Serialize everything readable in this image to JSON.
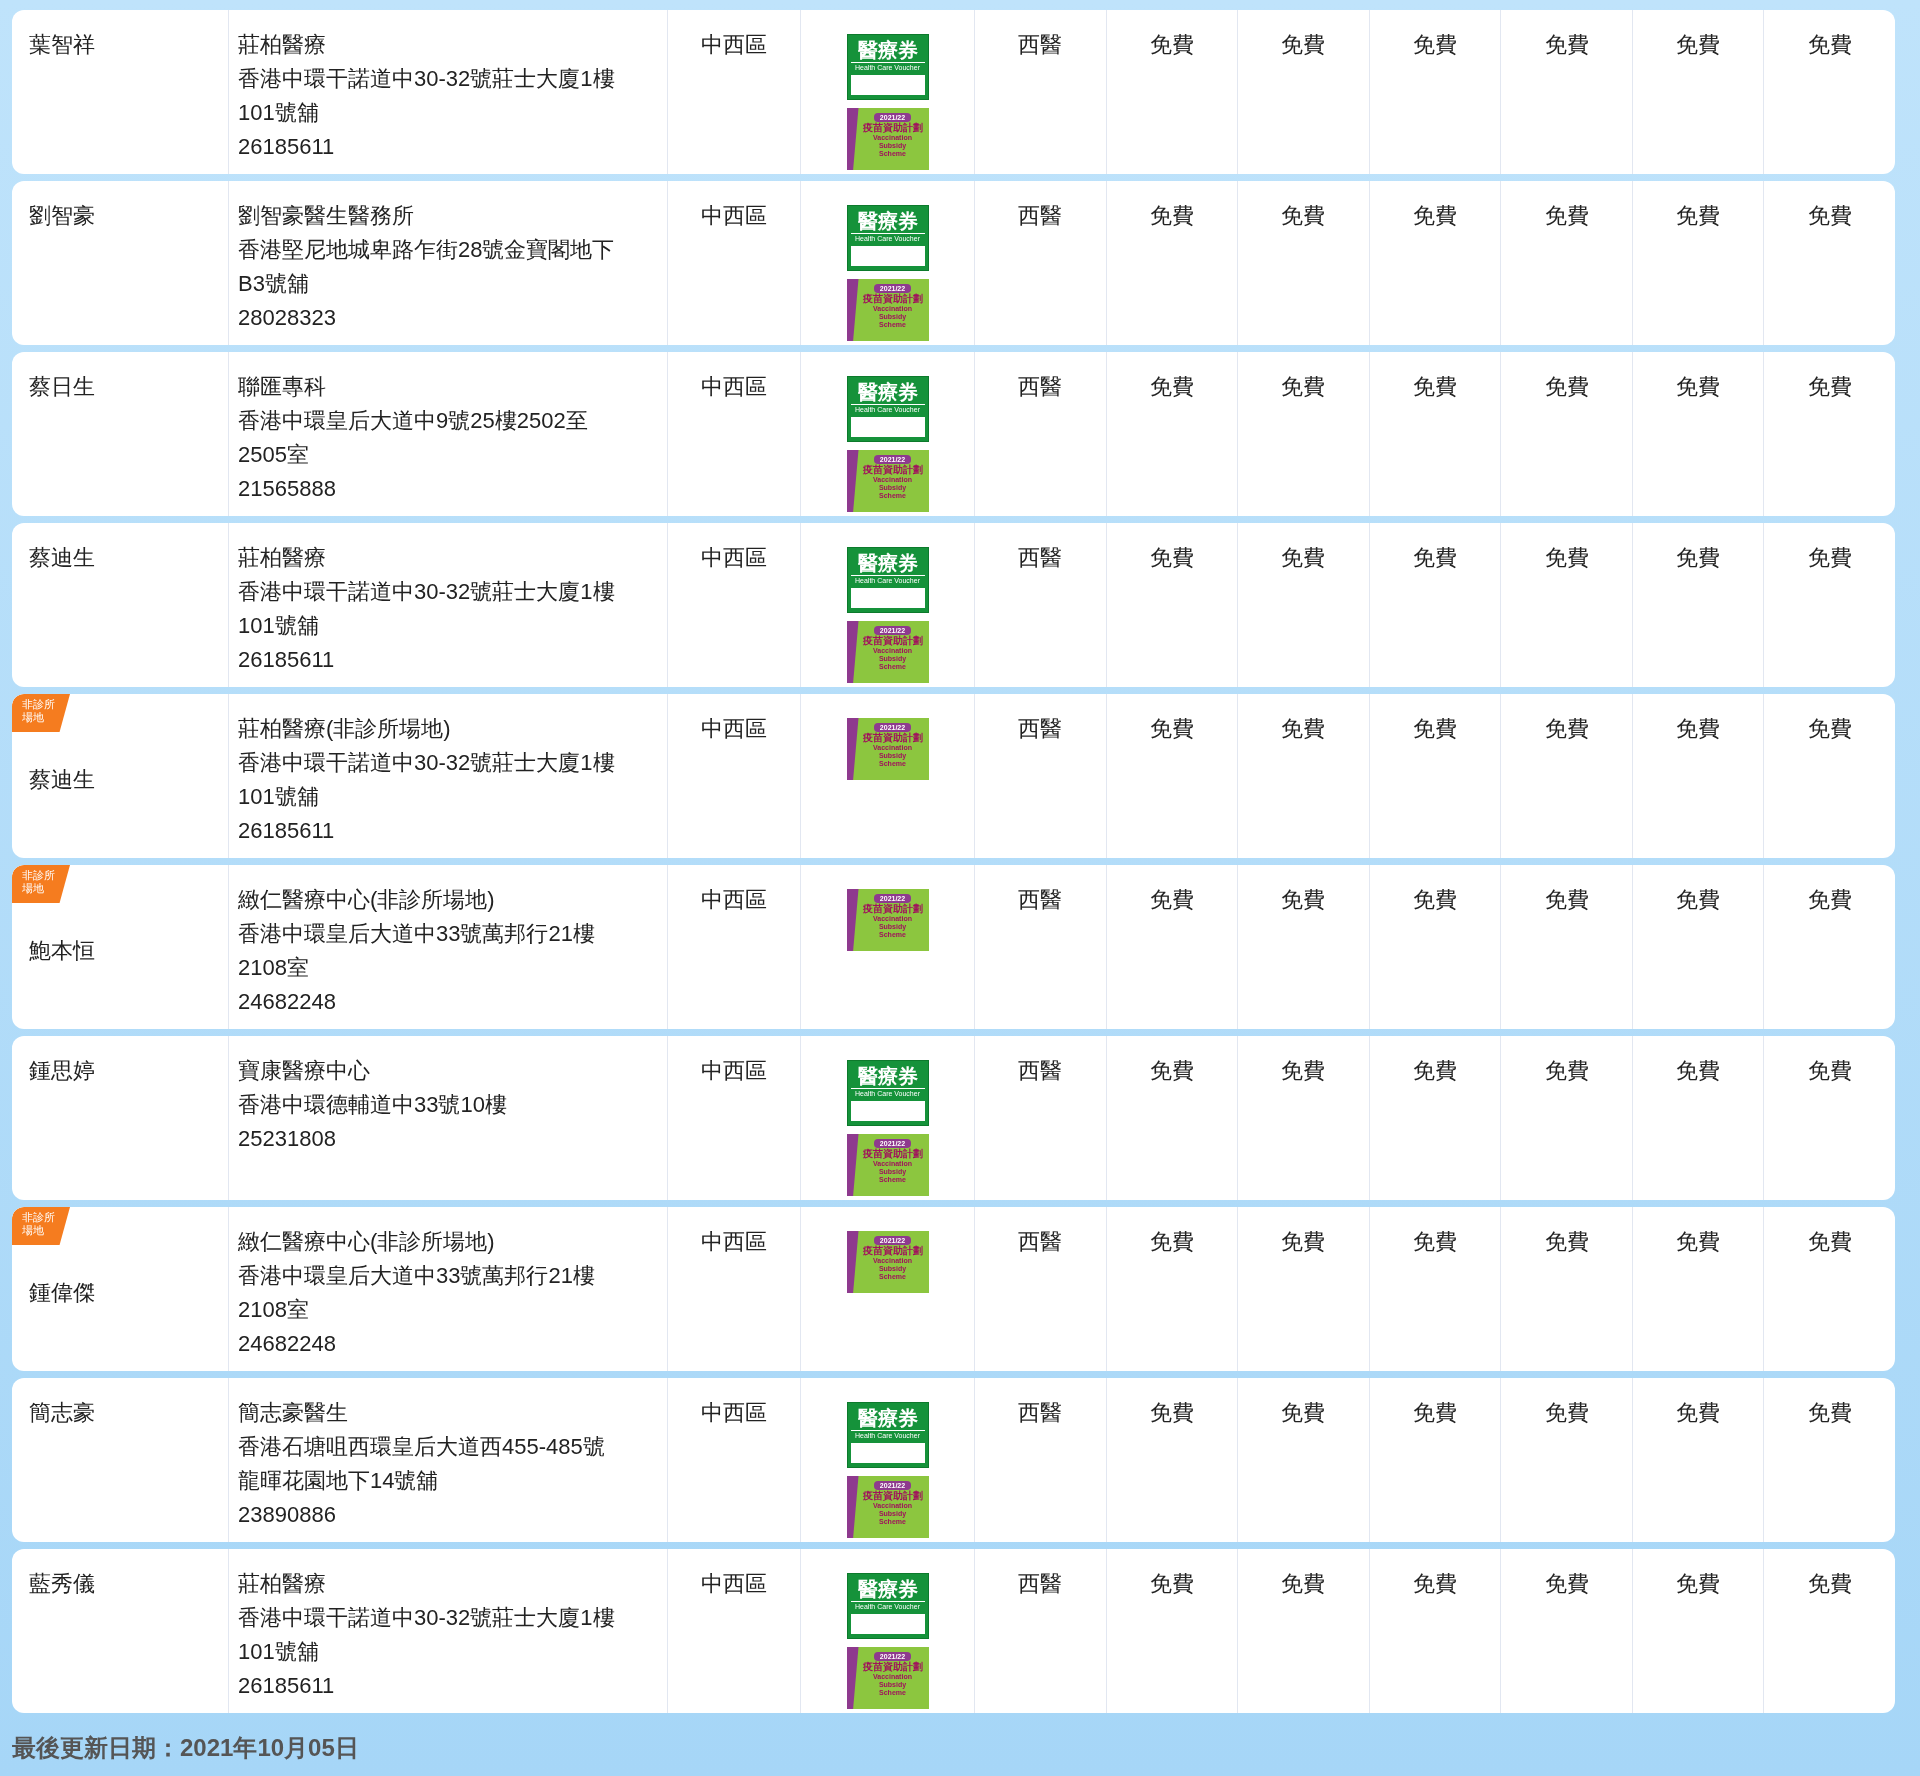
{
  "rows": [
    {
      "name": "葉智祥",
      "clinic": "莊柏醫療",
      "address": [
        "香港中環干諾道中30-32號莊士大廈1樓",
        "101號舖"
      ],
      "phone": "26185611",
      "district": "中西區",
      "schemes": [
        {
          "kind": "voucher",
          "title": "醫療券",
          "subtitle": "Health Care Voucher"
        },
        {
          "kind": "vaccination",
          "year": "2021/22",
          "title": "疫苗資助計劃",
          "subtitle": "Vaccination Subsidy Scheme"
        }
      ],
      "type": "西醫",
      "fees": [
        "免費",
        "免費",
        "免費",
        "免費",
        "免費",
        "免費"
      ]
    },
    {
      "name": "劉智豪",
      "clinic": "劉智豪醫生醫務所",
      "address": [
        "香港堅尼地城卑路乍街28號金寶閣地下",
        "B3號舖"
      ],
      "phone": "28028323",
      "district": "中西區",
      "schemes": [
        {
          "kind": "voucher",
          "title": "醫療券",
          "subtitle": "Health Care Voucher"
        },
        {
          "kind": "vaccination",
          "year": "2021/22",
          "title": "疫苗資助計劃",
          "subtitle": "Vaccination Subsidy Scheme"
        }
      ],
      "type": "西醫",
      "fees": [
        "免費",
        "免費",
        "免費",
        "免費",
        "免費",
        "免費"
      ]
    },
    {
      "name": "蔡日生",
      "clinic": "聯匯專科",
      "address": [
        "香港中環皇后大道中9號25樓2502至",
        "2505室"
      ],
      "phone": "21565888",
      "district": "中西區",
      "schemes": [
        {
          "kind": "voucher",
          "title": "醫療券",
          "subtitle": "Health Care Voucher"
        },
        {
          "kind": "vaccination",
          "year": "2021/22",
          "title": "疫苗資助計劃",
          "subtitle": "Vaccination Subsidy Scheme"
        }
      ],
      "type": "西醫",
      "fees": [
        "免費",
        "免費",
        "免費",
        "免費",
        "免費",
        "免費"
      ]
    },
    {
      "name": "蔡迪生",
      "clinic": "莊柏醫療",
      "address": [
        "香港中環干諾道中30-32號莊士大廈1樓",
        "101號舖"
      ],
      "phone": "26185611",
      "district": "中西區",
      "schemes": [
        {
          "kind": "voucher",
          "title": "醫療券",
          "subtitle": "Health Care Voucher"
        },
        {
          "kind": "vaccination",
          "year": "2021/22",
          "title": "疫苗資助計劃",
          "subtitle": "Vaccination Subsidy Scheme"
        }
      ],
      "type": "西醫",
      "fees": [
        "免費",
        "免費",
        "免費",
        "免費",
        "免費",
        "免費"
      ]
    },
    {
      "badge": "非診所場地",
      "name": "蔡迪生",
      "clinic": "莊柏醫療(非診所場地)",
      "address": [
        "香港中環干諾道中30-32號莊士大廈1樓",
        "101號舖"
      ],
      "phone": "26185611",
      "district": "中西區",
      "schemes": [
        {
          "kind": "vaccination",
          "year": "2021/22",
          "title": "疫苗資助計劃",
          "subtitle": "Vaccination Subsidy Scheme"
        }
      ],
      "type": "西醫",
      "fees": [
        "免費",
        "免費",
        "免費",
        "免費",
        "免費",
        "免費"
      ]
    },
    {
      "badge": "非診所場地",
      "name": "鮑本恒",
      "clinic": "緻仁醫療中心(非診所場地)",
      "address": [
        "香港中環皇后大道中33號萬邦行21樓",
        "2108室"
      ],
      "phone": "24682248",
      "district": "中西區",
      "schemes": [
        {
          "kind": "vaccination",
          "year": "2021/22",
          "title": "疫苗資助計劃",
          "subtitle": "Vaccination Subsidy Scheme"
        }
      ],
      "type": "西醫",
      "fees": [
        "免費",
        "免費",
        "免費",
        "免費",
        "免費",
        "免費"
      ]
    },
    {
      "name": "鍾思婷",
      "clinic": "寶康醫療中心",
      "address": [
        "香港中環德輔道中33號10樓"
      ],
      "phone": "25231808",
      "district": "中西區",
      "schemes": [
        {
          "kind": "voucher",
          "title": "醫療券",
          "subtitle": "Health Care Voucher"
        },
        {
          "kind": "vaccination",
          "year": "2021/22",
          "title": "疫苗資助計劃",
          "subtitle": "Vaccination Subsidy Scheme"
        }
      ],
      "type": "西醫",
      "fees": [
        "免費",
        "免費",
        "免費",
        "免費",
        "免費",
        "免費"
      ]
    },
    {
      "badge": "非診所場地",
      "name": "鍾偉傑",
      "clinic": "緻仁醫療中心(非診所場地)",
      "address": [
        "香港中環皇后大道中33號萬邦行21樓",
        "2108室"
      ],
      "phone": "24682248",
      "district": "中西區",
      "schemes": [
        {
          "kind": "vaccination",
          "year": "2021/22",
          "title": "疫苗資助計劃",
          "subtitle": "Vaccination Subsidy Scheme"
        }
      ],
      "type": "西醫",
      "fees": [
        "免費",
        "免費",
        "免費",
        "免費",
        "免費",
        "免費"
      ]
    },
    {
      "name": "簡志豪",
      "clinic": "簡志豪醫生",
      "address": [
        "香港石塘咀西環皇后大道西455-485號",
        "龍暉花園地下14號舖"
      ],
      "phone": "23890886",
      "district": "中西區",
      "schemes": [
        {
          "kind": "voucher",
          "title": "醫療券",
          "subtitle": "Health Care Voucher"
        },
        {
          "kind": "vaccination",
          "year": "2021/22",
          "title": "疫苗資助計劃",
          "subtitle": "Vaccination Subsidy Scheme"
        }
      ],
      "type": "西醫",
      "fees": [
        "免費",
        "免費",
        "免費",
        "免費",
        "免費",
        "免費"
      ]
    },
    {
      "name": "藍秀儀",
      "clinic": "莊柏醫療",
      "address": [
        "香港中環干諾道中30-32號莊士大廈1樓",
        "101號舖"
      ],
      "phone": "26185611",
      "district": "中西區",
      "schemes": [
        {
          "kind": "voucher",
          "title": "醫療券",
          "subtitle": "Health Care Voucher"
        },
        {
          "kind": "vaccination",
          "year": "2021/22",
          "title": "疫苗資助計劃",
          "subtitle": "Vaccination Subsidy Scheme"
        }
      ],
      "type": "西醫",
      "fees": [
        "免費",
        "免費",
        "免費",
        "免費",
        "免費",
        "免費"
      ]
    }
  ],
  "footer": "最後更新日期：2021年10月05日"
}
